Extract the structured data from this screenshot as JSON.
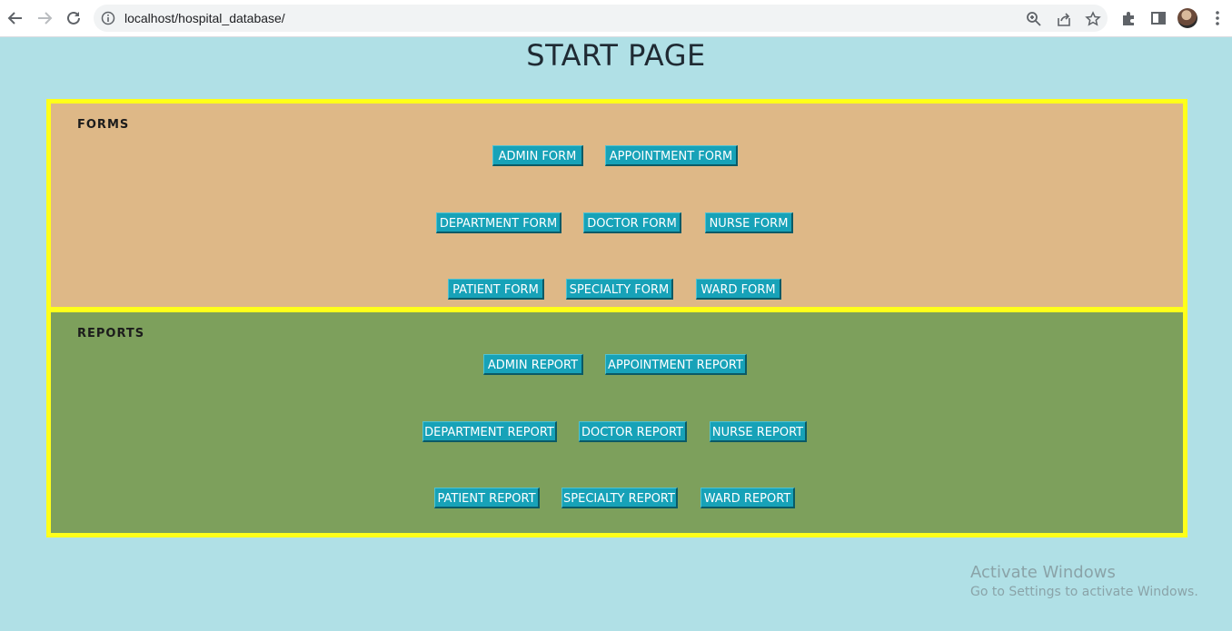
{
  "browser": {
    "url_host": "localhost",
    "url_path": "/hospital_database/"
  },
  "page": {
    "title": "START PAGE"
  },
  "forms": {
    "heading": "FORMS",
    "buttons": [
      "ADMIN FORM",
      "APPOINTMENT FORM",
      "DEPARTMENT FORM",
      "DOCTOR FORM",
      "NURSE FORM",
      "PATIENT FORM",
      "SPECIALTY FORM",
      "WARD FORM"
    ]
  },
  "reports": {
    "heading": "REPORTS",
    "buttons": [
      "ADMIN REPORT",
      "APPOINTMENT REPORT",
      "DEPARTMENT REPORT",
      "DOCTOR REPORT",
      "NURSE REPORT",
      "PATIENT REPORT",
      "SPECIALTY REPORT",
      "WARD REPORT"
    ]
  },
  "watermark": {
    "title": "Activate Windows",
    "subtitle": "Go to Settings to activate Windows."
  },
  "colors": {
    "page_bg": "#b0e0e6",
    "forms_bg": "#deb887",
    "reports_bg": "#7da05c",
    "panel_border": "#ffff1a",
    "button_bg": "#17a2b8"
  },
  "icons": {
    "back": "arrow-left-icon",
    "forward": "arrow-right-icon",
    "reload": "reload-icon",
    "info": "info-icon",
    "zoom": "zoom-icon",
    "share": "share-icon",
    "bookmark": "star-icon",
    "extensions": "puzzle-icon",
    "sidepanel": "side-panel-icon",
    "menu": "kebab-menu-icon"
  }
}
